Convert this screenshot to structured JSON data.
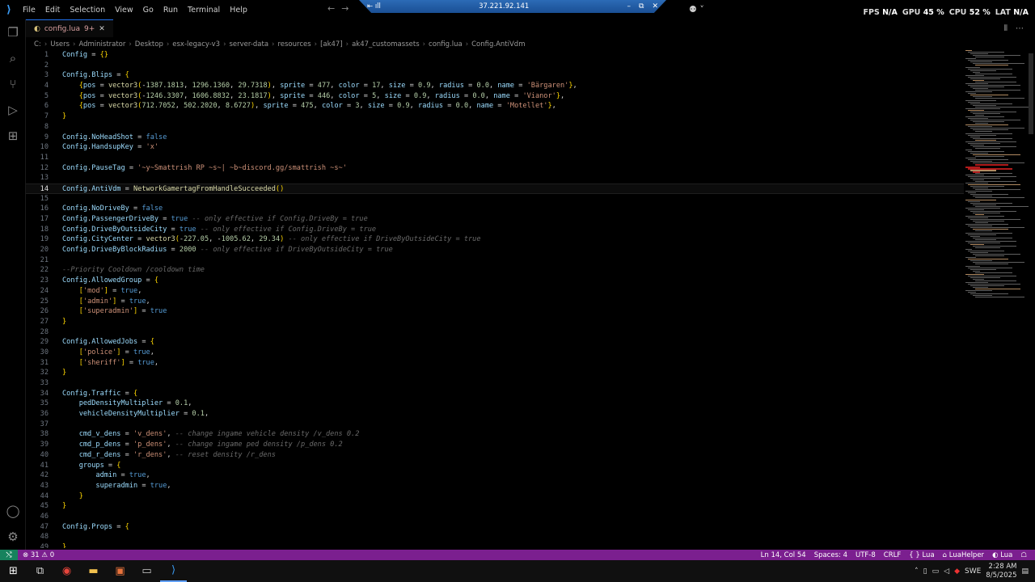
{
  "menu": [
    "File",
    "Edit",
    "Selection",
    "View",
    "Go",
    "Run",
    "Terminal",
    "Help"
  ],
  "rdp_ip": "37.221.92.141",
  "hud": {
    "fps_label": "FPS",
    "fps": "N/A",
    "gpu_label": "GPU",
    "gpu": "45 %",
    "cpu_label": "CPU",
    "cpu": "52 %",
    "lat_label": "LAT",
    "lat": "N/A"
  },
  "tab": {
    "name": "config.lua",
    "badge": "9+"
  },
  "breadcrumb": [
    "C:",
    "Users",
    "Administrator",
    "Desktop",
    "esx-legacy-v3",
    "server-data",
    "resources",
    "[ak47]",
    "ak47_customassets",
    "config.lua",
    "Config.AntiVdm"
  ],
  "current_line": 14,
  "lines": [
    {
      "n": "1",
      "t": "Config = {}"
    },
    {
      "n": "2",
      "t": ""
    },
    {
      "n": "3",
      "t": "Config.Blips = {"
    },
    {
      "n": "4",
      "t": "    {pos = vector3(-1387.1813, 1296.1360, 29.7318), sprite = 477, color = 17, size = 0.9, radius = 0.0, name = 'Bärgaren'},"
    },
    {
      "n": "5",
      "t": "    {pos = vector3(-1246.3307, 1606.8832, 23.1817), sprite = 446, color = 5, size = 0.9, radius = 0.0, name = 'Vianor'},"
    },
    {
      "n": "6",
      "t": "    {pos = vector3(712.7052, 502.2020, 8.6727), sprite = 475, color = 3, size = 0.9, radius = 0.0, name = 'Motellet'},"
    },
    {
      "n": "7",
      "t": "}"
    },
    {
      "n": "8",
      "t": ""
    },
    {
      "n": "9",
      "t": "Config.NoHeadShot = false"
    },
    {
      "n": "10",
      "t": "Config.HandsupKey = 'x'"
    },
    {
      "n": "11",
      "t": ""
    },
    {
      "n": "12",
      "t": "Config.PauseTag = '~y~Smattrish RP ~s~| ~b~discord.gg/smattrish ~s~'"
    },
    {
      "n": "13",
      "t": ""
    },
    {
      "n": "14",
      "t": "Config.AntiVdm = NetworkGamertagFromHandleSucceeded()"
    },
    {
      "n": "15",
      "t": ""
    },
    {
      "n": "16",
      "t": "Config.NoDriveBy = false"
    },
    {
      "n": "17",
      "t": "Config.PassengerDriveBy = true -- only effective if Config.DriveBy = true"
    },
    {
      "n": "18",
      "t": "Config.DriveByOutsideCity = true -- only effective if Config.DriveBy = true"
    },
    {
      "n": "19",
      "t": "Config.CityCenter = vector3(-227.05, -1005.62, 29.34) -- only effective if DriveByOutsideCity = true"
    },
    {
      "n": "20",
      "t": "Config.DriveByBlockRadius = 2000 -- only effective if DriveByOutsideCity = true"
    },
    {
      "n": "21",
      "t": ""
    },
    {
      "n": "22",
      "t": "--Priority Cooldown /cooldown time"
    },
    {
      "n": "23",
      "t": "Config.AllowedGroup = {"
    },
    {
      "n": "24",
      "t": "    ['mod'] = true,"
    },
    {
      "n": "25",
      "t": "    ['admin'] = true,"
    },
    {
      "n": "26",
      "t": "    ['superadmin'] = true"
    },
    {
      "n": "27",
      "t": "}"
    },
    {
      "n": "28",
      "t": ""
    },
    {
      "n": "29",
      "t": "Config.AllowedJobs = {"
    },
    {
      "n": "30",
      "t": "    ['police'] = true,"
    },
    {
      "n": "31",
      "t": "    ['sheriff'] = true,"
    },
    {
      "n": "32",
      "t": "}"
    },
    {
      "n": "33",
      "t": ""
    },
    {
      "n": "34",
      "t": "Config.Traffic = {"
    },
    {
      "n": "35",
      "t": "    pedDensityMultiplier = 0.1,"
    },
    {
      "n": "36",
      "t": "    vehicleDensityMultiplier = 0.1,"
    },
    {
      "n": "37",
      "t": ""
    },
    {
      "n": "38",
      "t": "    cmd_v_dens = 'v_dens', -- change ingame vehicle density /v_dens 0.2"
    },
    {
      "n": "39",
      "t": "    cmd_p_dens = 'p_dens', -- change ingame ped density /p_dens 0.2"
    },
    {
      "n": "40",
      "t": "    cmd_r_dens = 'r_dens', -- reset density /r_dens"
    },
    {
      "n": "41",
      "t": "    groups = {"
    },
    {
      "n": "42",
      "t": "        admin = true,"
    },
    {
      "n": "43",
      "t": "        superadmin = true,"
    },
    {
      "n": "44",
      "t": "    }"
    },
    {
      "n": "45",
      "t": "}"
    },
    {
      "n": "46",
      "t": ""
    },
    {
      "n": "47",
      "t": "Config.Props = {"
    },
    {
      "n": "48",
      "t": ""
    },
    {
      "n": "49",
      "t": "}"
    }
  ],
  "status": {
    "problems": "31",
    "warnings": "0",
    "position": "Ln 14, Col 54",
    "spaces": "Spaces: 4",
    "encoding": "UTF-8",
    "eol": "CRLF",
    "language_braces": "{ } Lua",
    "helper": "LuaHelper",
    "lang": "Lua"
  },
  "taskbar": {
    "lang": "SWE",
    "time": "2:28 AM",
    "date": "8/5/2025"
  },
  "icons": [
    "vscode-logo-icon",
    "explorer-icon",
    "search-icon",
    "source-control-icon",
    "run-debug-icon",
    "extensions-icon",
    "account-icon",
    "settings-gear-icon",
    "windows-start-icon",
    "task-view-icon",
    "chrome-icon",
    "file-explorer-icon",
    "app-icon",
    "terminal-icon",
    "vscode-taskbar-icon"
  ]
}
